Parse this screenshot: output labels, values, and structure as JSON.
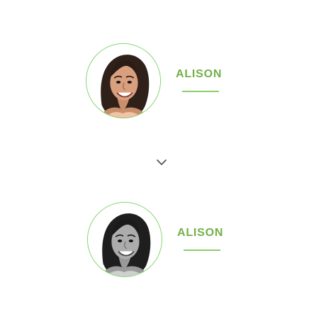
{
  "cards": [
    {
      "name": "ALISON",
      "accent_color": "#74b04a",
      "ring_color": "#7ed36a",
      "avatar_style": "color"
    },
    {
      "name": "ALISON",
      "accent_color": "#74b04a",
      "ring_color": "#7ed36a",
      "avatar_style": "grayscale"
    }
  ],
  "chevron": {
    "icon": "chevron-down-icon",
    "color": "#555555"
  }
}
